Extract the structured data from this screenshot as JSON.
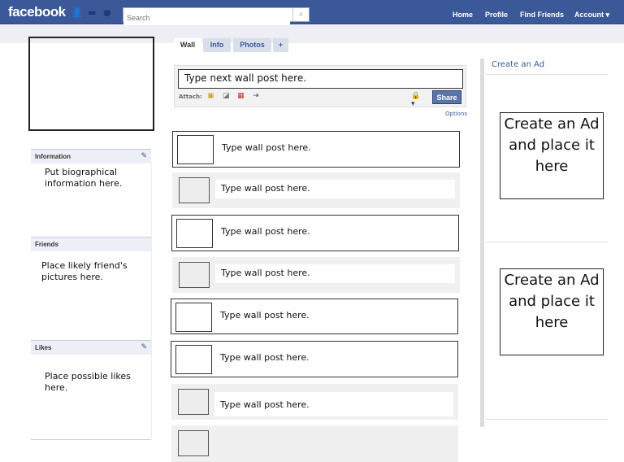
{
  "header": {
    "logo": "facebook",
    "search_placeholder": "Search",
    "nav": [
      "Home",
      "Profile",
      "Find Friends",
      "Account ▾"
    ]
  },
  "tabs": [
    "Wall",
    "Info",
    "Photos",
    "+"
  ],
  "left": {
    "sections": [
      {
        "title": "Information",
        "text": "Put biographical information here."
      },
      {
        "title": "Friends",
        "text": "Place likely friend's pictures here."
      },
      {
        "title": "Likes",
        "text": "Place possible likes here."
      }
    ]
  },
  "composer": {
    "value": "Type next wall post here.",
    "attach_label": "Attach:",
    "share": "Share",
    "options": "Options"
  },
  "posts": [
    "Type wall post here.",
    "Type wall post here.",
    "Type wall post here.",
    "Type wall post here.",
    "Type wall post here.",
    "Type wall post here.",
    "Type wall post here.",
    ""
  ],
  "ads": {
    "link": "Create an Ad",
    "ad_text": "Create an Ad and place it here"
  },
  "colors": {
    "brand": "#3b5998"
  }
}
